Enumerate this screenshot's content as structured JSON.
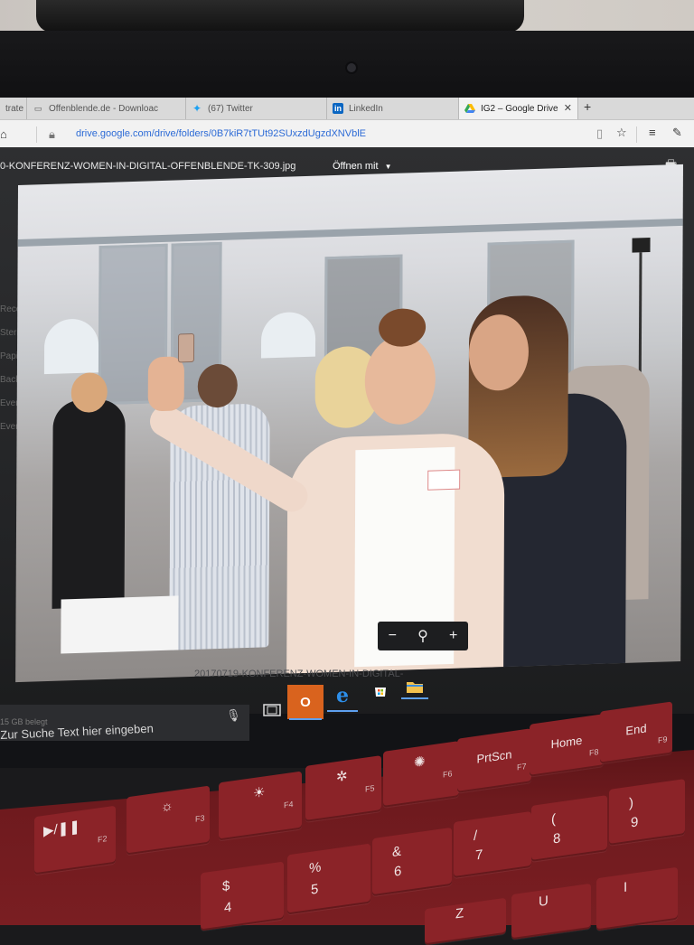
{
  "browser": {
    "tabs": [
      {
        "label": "trate",
        "icon": "page-icon"
      },
      {
        "label": "Offenblende.de - Downloac",
        "icon": "page-icon"
      },
      {
        "label": "(67) Twitter",
        "icon": "twitter-icon"
      },
      {
        "label": "LinkedIn",
        "icon": "linkedin-icon"
      },
      {
        "label": "IG2 – Google Drive",
        "icon": "google-drive-icon",
        "active": true
      }
    ],
    "new_tab": "+",
    "url": "drive.google.com/drive/folders/0B7kiR7tTUt92SUxzdUgzdXNVblE"
  },
  "drive": {
    "file_name": "0-KONFERENZ-WOMEN-IN-DIGITAL-OFFENBLENDE-TK-309.jpg",
    "open_with": "Öffnen mit",
    "side_items": [
      "Recen",
      "Sterne",
      "Papie",
      "Backu",
      "Events",
      "Events"
    ],
    "caption_ghost": "20170719-KONFERENZ-WOMEN-IN-DIGITAL-"
  },
  "zoom": {
    "minus": "−",
    "magnifier": "⚲",
    "plus": "+"
  },
  "taskbar": {
    "search_placeholder": "Zur Suche Text hier eingeben",
    "storage": "15 GB belegt",
    "outlook_label": "O",
    "edge_label": "e"
  },
  "keyboard": {
    "row1": [
      {
        "main": "",
        "fn": "F3",
        "sym": "☼"
      },
      {
        "main": "",
        "fn": "F4",
        "sym": "☀"
      },
      {
        "main": "",
        "fn": "F5",
        "sym": "✲"
      },
      {
        "main": "",
        "fn": "F6",
        "sym": "✺"
      },
      {
        "main": "PrtScn",
        "fn": "F7",
        "sym": ""
      },
      {
        "main": "Home",
        "fn": "F8",
        "sym": ""
      },
      {
        "main": "End",
        "fn": "F9",
        "sym": ""
      }
    ],
    "row2": [
      {
        "main": "4",
        "alt": "$"
      },
      {
        "main": "5",
        "alt": "%"
      },
      {
        "main": "6",
        "alt": "&"
      },
      {
        "main": "7",
        "alt": "/"
      },
      {
        "main": "8",
        "alt": "("
      },
      {
        "main": "9",
        "alt": ")"
      }
    ],
    "play_key": "▶/❚❚",
    "play_fn": "F2",
    "letters": [
      "Z",
      "U",
      "I"
    ]
  }
}
